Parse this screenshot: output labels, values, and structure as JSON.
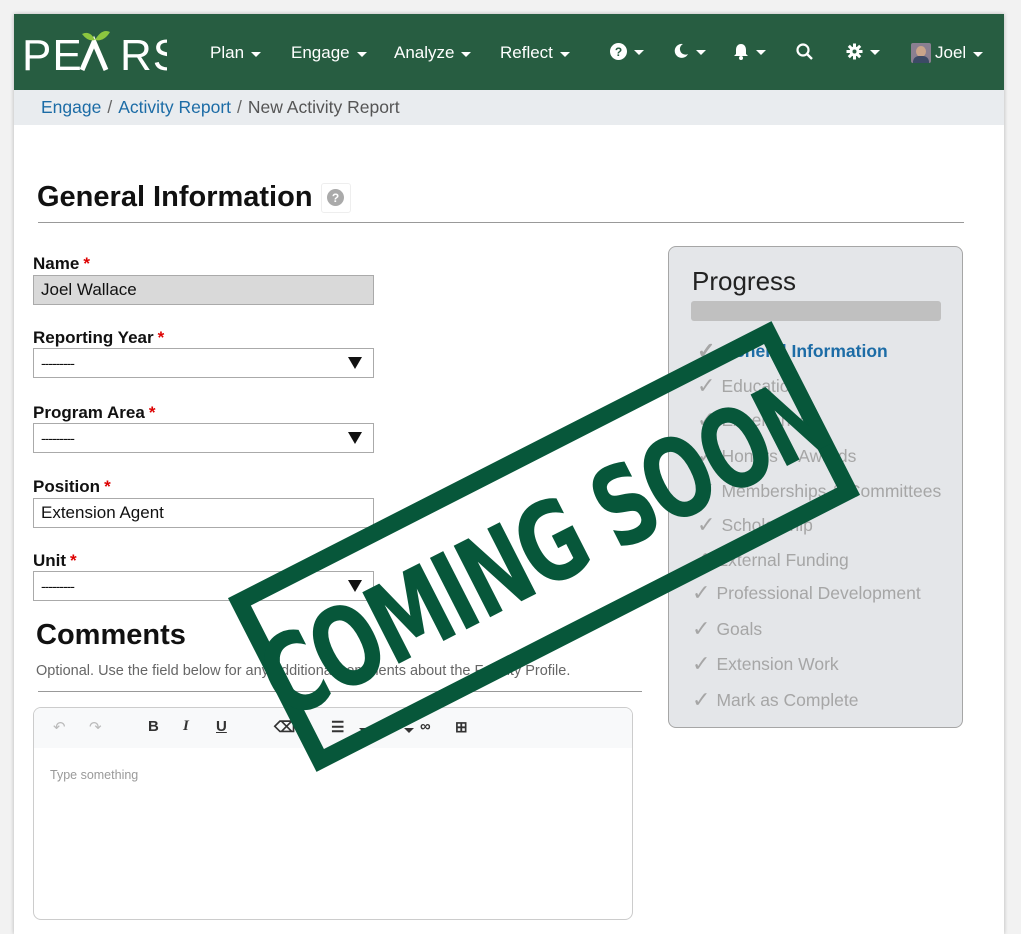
{
  "app": {
    "logo": "PEARS"
  },
  "nav": {
    "items": [
      {
        "label": "Plan"
      },
      {
        "label": "Engage"
      },
      {
        "label": "Analyze"
      },
      {
        "label": "Reflect"
      }
    ],
    "user": "Joel",
    "icons": [
      "help-icon",
      "moon-icon",
      "bell-icon",
      "search-icon",
      "gear-icon"
    ]
  },
  "breadcrumb": {
    "items": [
      "Engage",
      "Activity Report"
    ],
    "current": "New Activity Report",
    "separator": "/"
  },
  "general": {
    "title": "General Information",
    "help_glyph": "?"
  },
  "fields": {
    "name": {
      "label": "Name",
      "required": "*",
      "value": "Joel Wallace"
    },
    "reporting_year": {
      "label": "Reporting Year",
      "required": "*",
      "value": "---------"
    },
    "program_area": {
      "label": "Program Area",
      "required": "*",
      "value": "---------"
    },
    "position": {
      "label": "Position",
      "required": "*",
      "value": "Extension Agent"
    },
    "unit": {
      "label": "Unit",
      "required": "*",
      "value": "---------"
    }
  },
  "comments": {
    "title": "Comments",
    "help": "Optional. Use the field below for any additional comments about the Faculty Profile.",
    "placeholder": "Type something",
    "toolbar": {
      "undo": "↶",
      "redo": "↷",
      "bold": "B",
      "italic": "I",
      "underline": "U",
      "eraser": "⌫",
      "bullet_list": "☰",
      "ordered_list": "≡",
      "link": "∞",
      "table": "⊞"
    }
  },
  "progress": {
    "title": "Progress",
    "check": "✓",
    "steps": [
      {
        "label": "General Information",
        "active": true
      },
      {
        "label": "Education"
      },
      {
        "label": "Experience"
      },
      {
        "label": "Honors & Awards"
      },
      {
        "label": "Memberships & Committees"
      },
      {
        "label": "Scholarship"
      },
      {
        "label": "External Funding"
      },
      {
        "label": "Professional Development"
      },
      {
        "label": "Goals"
      },
      {
        "label": "Extension Work"
      },
      {
        "label": "Mark as Complete"
      }
    ]
  },
  "overlay": {
    "stamp": "COMING SOON"
  },
  "colors": {
    "brand": "#275d41",
    "link": "#1c6ca6",
    "stamp": "#07573a",
    "required": "#dd0000"
  }
}
